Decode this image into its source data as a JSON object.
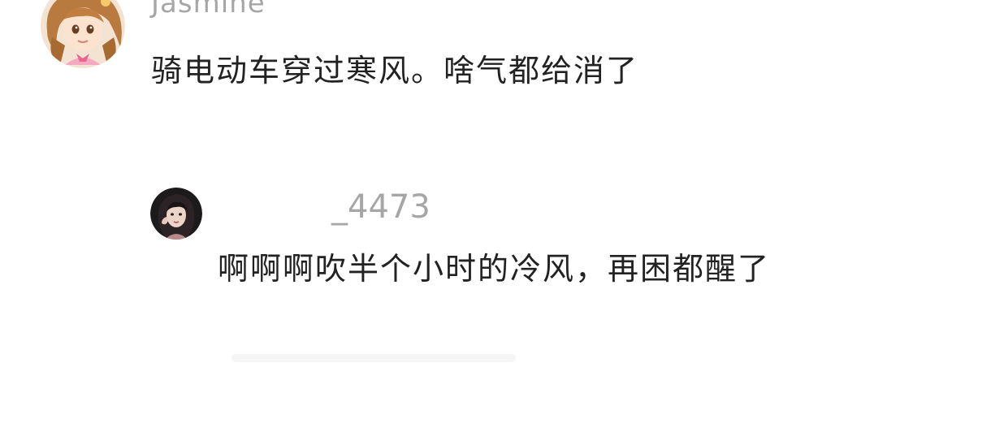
{
  "comments": [
    {
      "username": "Jasmine",
      "text": "骑电动车穿过寒风。啥气都给消了",
      "avatar_icon": "anime-girl-avatar-icon"
    },
    {
      "username": "_4473",
      "text": "啊啊啊吹半个小时的冷风，再困都醒了",
      "avatar_icon": "portrait-avatar-icon"
    }
  ],
  "colors": {
    "username": "#a6a6a6",
    "text": "#222222",
    "background": "#ffffff"
  }
}
